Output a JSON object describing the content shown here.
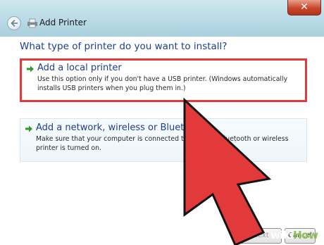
{
  "window": {
    "title": "Add Printer",
    "close_symbol": "✕",
    "back_icon": "back-arrow-icon",
    "printer_icon": "printer-icon"
  },
  "main": {
    "heading": "What type of printer do you want to install?",
    "options": [
      {
        "title": "Add a local printer",
        "description": "Use this option only if you don't have a USB printer. (Windows automatically installs USB printers when you plug them in.)",
        "selected": true
      },
      {
        "title": "Add a network, wireless or Bluetooth",
        "description": "Make sure that your computer is connected to the                    your Bluetooth or wireless printer is turned on.",
        "selected": false
      }
    ]
  },
  "footer": {
    "next_label": "Next",
    "cancel_label": "Cancel"
  },
  "colors": {
    "highlight": "#e23a3a",
    "pointer": "#e23a3a",
    "heading": "#1e3d8f"
  },
  "watermark": {
    "part1": "wiki",
    "part2": "How"
  }
}
